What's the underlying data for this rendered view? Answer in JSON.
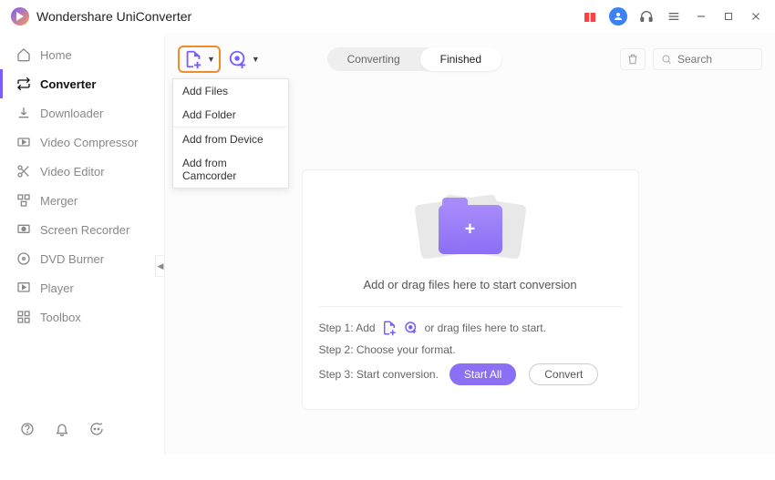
{
  "app": {
    "title": "Wondershare UniConverter"
  },
  "sidebar": {
    "items": [
      {
        "label": "Home"
      },
      {
        "label": "Converter"
      },
      {
        "label": "Downloader"
      },
      {
        "label": "Video Compressor"
      },
      {
        "label": "Video Editor"
      },
      {
        "label": "Merger"
      },
      {
        "label": "Screen Recorder"
      },
      {
        "label": "DVD Burner"
      },
      {
        "label": "Player"
      },
      {
        "label": "Toolbox"
      }
    ]
  },
  "toolbar": {
    "menu": {
      "add_files": "Add Files",
      "add_folder": "Add Folder",
      "add_device": "Add from Device",
      "add_camcorder": "Add from Camcorder"
    },
    "seg": {
      "converting": "Converting",
      "finished": "Finished"
    },
    "search_placeholder": "Search"
  },
  "dropzone": {
    "main_text": "Add or drag files here to start conversion",
    "step1_prefix": "Step 1: Add",
    "step1_suffix": "or drag files here to start.",
    "step2": "Step 2: Choose your format.",
    "step3": "Step 3: Start conversion.",
    "start_all": "Start All",
    "convert": "Convert"
  }
}
